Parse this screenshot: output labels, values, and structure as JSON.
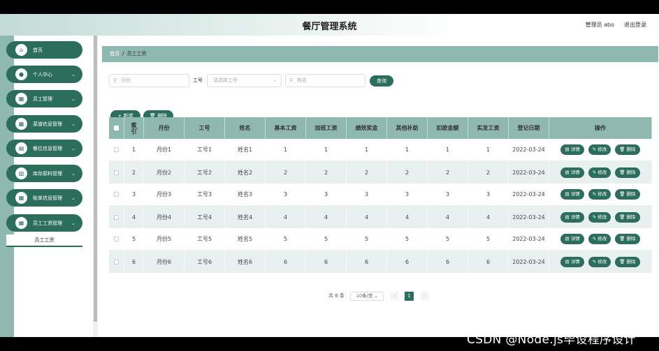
{
  "header": {
    "title": "餐厅管理系统",
    "user_label": "管理员 abo",
    "logout_label": "退出登录"
  },
  "sidebar": {
    "items": [
      {
        "label": "首页",
        "icon": "home-icon",
        "glyph": "⌂",
        "has_chevron": false
      },
      {
        "label": "个人中心",
        "icon": "user-icon",
        "glyph": "●",
        "has_chevron": true
      },
      {
        "label": "员工管理",
        "icon": "grid-icon",
        "glyph": "▦",
        "has_chevron": true
      },
      {
        "label": "菜谱信息管理",
        "icon": "grid-icon",
        "glyph": "▦",
        "has_chevron": true
      },
      {
        "label": "餐位信息管理",
        "icon": "grid-icon",
        "glyph": "▤",
        "has_chevron": true
      },
      {
        "label": "库存原料管理",
        "icon": "grid-icon",
        "glyph": "▥",
        "has_chevron": true
      },
      {
        "label": "账单信息管理",
        "icon": "grid-icon",
        "glyph": "▦",
        "has_chevron": true
      },
      {
        "label": "员工工资管理",
        "icon": "grid-icon",
        "glyph": "▦",
        "has_chevron": true
      }
    ],
    "submenu": "员工工资"
  },
  "breadcrumb": {
    "home": "首页",
    "separator": "/",
    "current": "员工工资"
  },
  "search": {
    "month_placeholder": "月份",
    "job_label": "工号",
    "job_placeholder": "请选择工号",
    "name_placeholder": "姓名",
    "search_button": "查询"
  },
  "actions": {
    "add": "+ 新增",
    "delete": "删除"
  },
  "table": {
    "headers": [
      "索引",
      "月份",
      "工号",
      "姓名",
      "基本工资",
      "加班工资",
      "绩效奖金",
      "其他补助",
      "扣款金额",
      "实发工资",
      "登记日期",
      "操作"
    ],
    "rows": [
      [
        "1",
        "月份1",
        "工号1",
        "姓名1",
        "1",
        "1",
        "1",
        "1",
        "1",
        "1",
        "2022-03-24"
      ],
      [
        "2",
        "月份2",
        "工号2",
        "姓名2",
        "2",
        "2",
        "2",
        "2",
        "2",
        "2",
        "2022-03-24"
      ],
      [
        "3",
        "月份3",
        "工号3",
        "姓名3",
        "3",
        "3",
        "3",
        "3",
        "3",
        "3",
        "2022-03-24"
      ],
      [
        "4",
        "月份4",
        "工号4",
        "姓名4",
        "4",
        "4",
        "4",
        "4",
        "4",
        "4",
        "2022-03-24"
      ],
      [
        "5",
        "月份5",
        "工号5",
        "姓名5",
        "5",
        "5",
        "5",
        "5",
        "5",
        "5",
        "2022-03-24"
      ],
      [
        "6",
        "月份6",
        "工号6",
        "姓名6",
        "6",
        "6",
        "6",
        "6",
        "6",
        "6",
        "2022-03-24"
      ]
    ],
    "row_actions": [
      "详情",
      "修改",
      "删除"
    ]
  },
  "pager": {
    "total": "共 6 条",
    "page_size": "10条/页",
    "current": "1"
  },
  "watermark": "CSDN @Node.js毕设程序设计",
  "colors": {
    "accent": "#2c6e5c",
    "header_row": "#8fb9b0",
    "alt_row": "#e8f1ef"
  }
}
